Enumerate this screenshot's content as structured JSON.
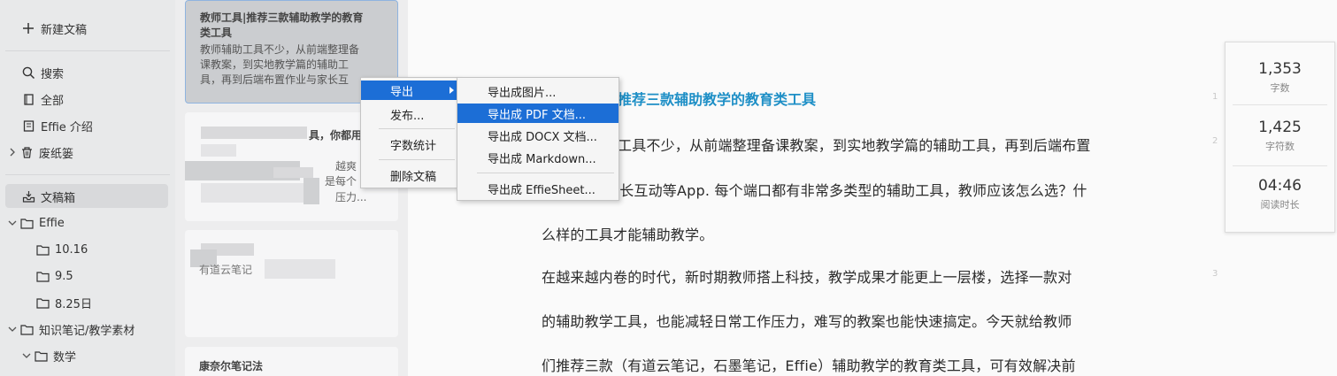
{
  "sidebar": {
    "new_doc": "新建文稿",
    "search": "搜索",
    "all": "全部",
    "intro": "Effie 介绍",
    "trash": "废纸篓",
    "inbox": "文稿箱",
    "folders": [
      {
        "label": "Effie"
      },
      {
        "label": "10.16"
      },
      {
        "label": "9.5"
      },
      {
        "label": "8.25日"
      },
      {
        "label": "知识笔记/教学素材"
      },
      {
        "label": "数学"
      }
    ]
  },
  "doclist": {
    "active": {
      "title_l1": "教师工具|推荐三款辅助教学的教育",
      "title_l2": "类工具",
      "body_l1": "教师辅助工具不少，从前端整理备",
      "body_l2": "课教案，到实地教学篇的辅助工",
      "body_l3": "具，再到后端布置作业与家长互"
    },
    "card2": {
      "frag1": "具，你都用",
      "frag2": "越爽",
      "frag3": "是每个",
      "frag4": "压力..."
    },
    "card3": {
      "frag1": "有道云笔记"
    },
    "card4": {
      "title": "康奈尔笔记法"
    }
  },
  "context_menu": {
    "items": [
      "导出",
      "发布...",
      "字数统计",
      "删除文稿"
    ]
  },
  "export_menu": {
    "items": [
      "导出成图片...",
      "导出成 PDF 文档...",
      "导出成 DOCX 文档...",
      "导出成 Markdown...",
      "导出成 EffieSheet..."
    ]
  },
  "editor": {
    "title_visible": "推荐三款辅助教学的教育类工具",
    "lines": [
      "工具不少，从前端整理备课教案，到实地教学篇的辅助工具，再到后端布置",
      "家长互动等App. 每个端口都有非常多类型的辅助工具，教师应该怎么选？什",
      "么样的工具才能辅助教学。",
      "在越来越内卷的时代，新时期教师搭上科技，教学成果才能更上一层楼，选择一款对",
      "的辅助教学工具，也能减轻日常工作压力，难写的教案也能快速搞定。今天就给教师",
      "们推荐三款（有道云笔记，石墨笔记，Effie）辅助教学的教育类工具，可有效解决前"
    ],
    "line_numbers": [
      "1",
      "2",
      "3"
    ]
  },
  "stats": {
    "words": "1,353",
    "words_label": "字数",
    "chars": "1,425",
    "chars_label": "字符数",
    "read_time": "04:46",
    "read_label": "阅读时长"
  },
  "colors": {
    "accent_title": "#1e8fc6",
    "menu_highlight": "#1c6ed6"
  }
}
